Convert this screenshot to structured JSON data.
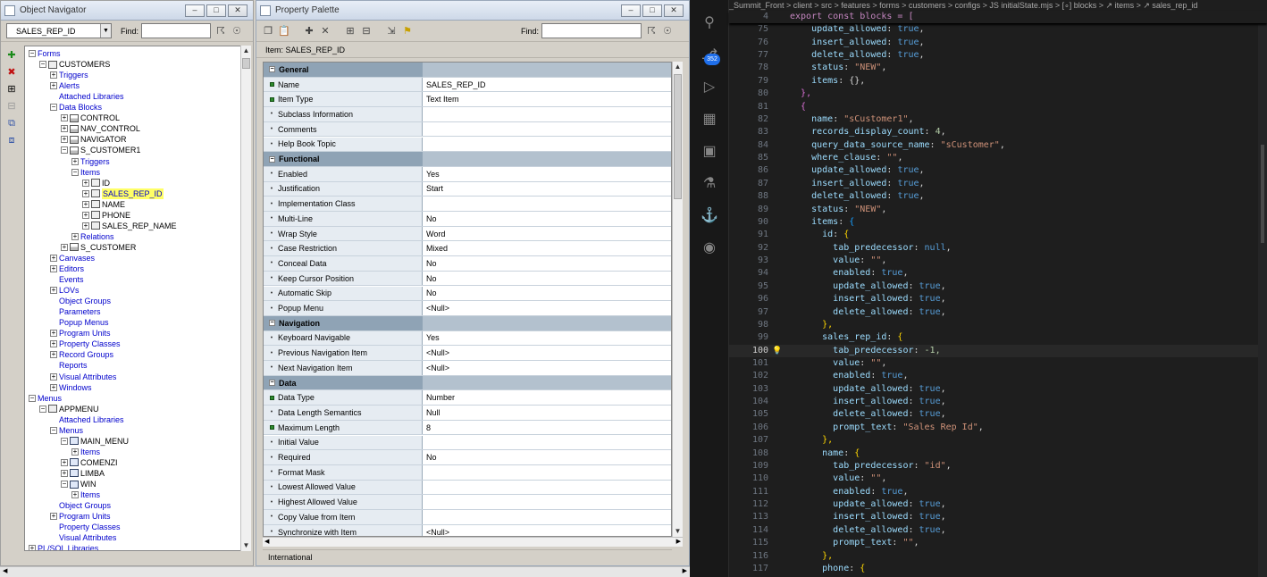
{
  "navigator": {
    "title": "Object Navigator",
    "selector_value": "SALES_REP_ID",
    "find_label": "Find:",
    "tree": [
      {
        "depth": 0,
        "toggle": "-",
        "icon": "",
        "label": "Forms",
        "color": "blue"
      },
      {
        "depth": 1,
        "toggle": "-",
        "icon": "form",
        "label": "CUSTOMERS",
        "color": "black"
      },
      {
        "depth": 2,
        "toggle": "+",
        "icon": "",
        "label": "Triggers",
        "color": "blue"
      },
      {
        "depth": 2,
        "toggle": "+",
        "icon": "",
        "label": "Alerts",
        "color": "blue"
      },
      {
        "depth": 2,
        "toggle": "",
        "icon": "",
        "label": "Attached Libraries",
        "color": "blue"
      },
      {
        "depth": 2,
        "toggle": "-",
        "icon": "",
        "label": "Data Blocks",
        "color": "blue"
      },
      {
        "depth": 3,
        "toggle": "+",
        "icon": "block",
        "label": "CONTROL",
        "color": "black"
      },
      {
        "depth": 3,
        "toggle": "+",
        "icon": "block",
        "label": "NAV_CONTROL",
        "color": "black"
      },
      {
        "depth": 3,
        "toggle": "+",
        "icon": "block",
        "label": "NAVIGATOR",
        "color": "black"
      },
      {
        "depth": 3,
        "toggle": "-",
        "icon": "block",
        "label": "S_CUSTOMER1",
        "color": "black"
      },
      {
        "depth": 4,
        "toggle": "+",
        "icon": "",
        "label": "Triggers",
        "color": "blue"
      },
      {
        "depth": 4,
        "toggle": "-",
        "icon": "",
        "label": "Items",
        "color": "blue"
      },
      {
        "depth": 5,
        "toggle": "+",
        "icon": "item",
        "label": "ID",
        "color": "black"
      },
      {
        "depth": 5,
        "toggle": "+",
        "icon": "item",
        "label": "SALES_REP_ID",
        "color": "selected"
      },
      {
        "depth": 5,
        "toggle": "+",
        "icon": "item",
        "label": "NAME",
        "color": "black"
      },
      {
        "depth": 5,
        "toggle": "+",
        "icon": "item",
        "label": "PHONE",
        "color": "black"
      },
      {
        "depth": 5,
        "toggle": "+",
        "icon": "item",
        "label": "SALES_REP_NAME",
        "color": "black"
      },
      {
        "depth": 4,
        "toggle": "+",
        "icon": "",
        "label": "Relations",
        "color": "blue"
      },
      {
        "depth": 3,
        "toggle": "+",
        "icon": "block",
        "label": "S_CUSTOMER",
        "color": "black"
      },
      {
        "depth": 2,
        "toggle": "+",
        "icon": "",
        "label": "Canvases",
        "color": "blue"
      },
      {
        "depth": 2,
        "toggle": "+",
        "icon": "",
        "label": "Editors",
        "color": "blue"
      },
      {
        "depth": 2,
        "toggle": "",
        "icon": "",
        "label": "Events",
        "color": "blue"
      },
      {
        "depth": 2,
        "toggle": "+",
        "icon": "",
        "label": "LOVs",
        "color": "blue"
      },
      {
        "depth": 2,
        "toggle": "",
        "icon": "",
        "label": "Object Groups",
        "color": "blue"
      },
      {
        "depth": 2,
        "toggle": "",
        "icon": "",
        "label": "Parameters",
        "color": "blue"
      },
      {
        "depth": 2,
        "toggle": "",
        "icon": "",
        "label": "Popup Menus",
        "color": "blue"
      },
      {
        "depth": 2,
        "toggle": "+",
        "icon": "",
        "label": "Program Units",
        "color": "blue"
      },
      {
        "depth": 2,
        "toggle": "+",
        "icon": "",
        "label": "Property Classes",
        "color": "blue"
      },
      {
        "depth": 2,
        "toggle": "+",
        "icon": "",
        "label": "Record Groups",
        "color": "blue"
      },
      {
        "depth": 2,
        "toggle": "",
        "icon": "",
        "label": "Reports",
        "color": "blue"
      },
      {
        "depth": 2,
        "toggle": "+",
        "icon": "",
        "label": "Visual Attributes",
        "color": "blue"
      },
      {
        "depth": 2,
        "toggle": "+",
        "icon": "",
        "label": "Windows",
        "color": "blue"
      },
      {
        "depth": 0,
        "toggle": "-",
        "icon": "",
        "label": "Menus",
        "color": "blue"
      },
      {
        "depth": 1,
        "toggle": "-",
        "icon": "form",
        "label": "APPMENU",
        "color": "black"
      },
      {
        "depth": 2,
        "toggle": "",
        "icon": "",
        "label": "Attached Libraries",
        "color": "blue"
      },
      {
        "depth": 2,
        "toggle": "-",
        "icon": "",
        "label": "Menus",
        "color": "blue"
      },
      {
        "depth": 3,
        "toggle": "-",
        "icon": "menu",
        "label": "MAIN_MENU",
        "color": "black"
      },
      {
        "depth": 4,
        "toggle": "+",
        "icon": "",
        "label": "Items",
        "color": "blue"
      },
      {
        "depth": 3,
        "toggle": "+",
        "icon": "menu",
        "label": "COMENZI",
        "color": "black"
      },
      {
        "depth": 3,
        "toggle": "+",
        "icon": "menu",
        "label": "LIMBA",
        "color": "black"
      },
      {
        "depth": 3,
        "toggle": "-",
        "icon": "menu",
        "label": "WIN",
        "color": "black"
      },
      {
        "depth": 4,
        "toggle": "+",
        "icon": "",
        "label": "Items",
        "color": "blue"
      },
      {
        "depth": 2,
        "toggle": "",
        "icon": "",
        "label": "Object Groups",
        "color": "blue"
      },
      {
        "depth": 2,
        "toggle": "+",
        "icon": "",
        "label": "Program Units",
        "color": "blue"
      },
      {
        "depth": 2,
        "toggle": "",
        "icon": "",
        "label": "Property Classes",
        "color": "blue"
      },
      {
        "depth": 2,
        "toggle": "",
        "icon": "",
        "label": "Visual Attributes",
        "color": "blue"
      },
      {
        "depth": 0,
        "toggle": "+",
        "icon": "",
        "label": "PL/SQL Libraries",
        "color": "blue"
      }
    ]
  },
  "palette": {
    "title": "Property Palette",
    "find_label": "Find:",
    "item_label": "Item: SALES_REP_ID",
    "status": "International",
    "rows": [
      {
        "type": "cat",
        "name": "General",
        "value": ""
      },
      {
        "type": "prop",
        "mark": "sq",
        "name": "Name",
        "value": "SALES_REP_ID"
      },
      {
        "type": "prop",
        "mark": "sq",
        "name": "Item Type",
        "value": "Text Item"
      },
      {
        "type": "prop",
        "mark": "dot",
        "name": "Subclass Information",
        "value": ""
      },
      {
        "type": "prop",
        "mark": "dot",
        "name": "Comments",
        "value": ""
      },
      {
        "type": "prop",
        "mark": "dot",
        "name": "Help Book Topic",
        "value": ""
      },
      {
        "type": "cat",
        "name": "Functional",
        "value": ""
      },
      {
        "type": "prop",
        "mark": "dot",
        "name": "Enabled",
        "value": "Yes"
      },
      {
        "type": "prop",
        "mark": "dot",
        "name": "Justification",
        "value": "Start"
      },
      {
        "type": "prop",
        "mark": "dot",
        "name": "Implementation Class",
        "value": ""
      },
      {
        "type": "prop",
        "mark": "dot",
        "name": "Multi-Line",
        "value": "No"
      },
      {
        "type": "prop",
        "mark": "dot",
        "name": "Wrap Style",
        "value": "Word"
      },
      {
        "type": "prop",
        "mark": "dot",
        "name": "Case Restriction",
        "value": "Mixed"
      },
      {
        "type": "prop",
        "mark": "dot",
        "name": "Conceal Data",
        "value": "No"
      },
      {
        "type": "prop",
        "mark": "dot",
        "name": "Keep Cursor Position",
        "value": "No"
      },
      {
        "type": "prop",
        "mark": "dot",
        "name": "Automatic Skip",
        "value": "No"
      },
      {
        "type": "prop",
        "mark": "dot",
        "name": "Popup Menu",
        "value": "<Null>"
      },
      {
        "type": "cat",
        "name": "Navigation",
        "value": ""
      },
      {
        "type": "prop",
        "mark": "dot",
        "name": "Keyboard Navigable",
        "value": "Yes"
      },
      {
        "type": "prop",
        "mark": "dot",
        "name": "Previous Navigation Item",
        "value": "<Null>"
      },
      {
        "type": "prop",
        "mark": "dot",
        "name": "Next Navigation Item",
        "value": "<Null>"
      },
      {
        "type": "cat",
        "name": "Data",
        "value": ""
      },
      {
        "type": "prop",
        "mark": "sq",
        "name": "Data Type",
        "value": "Number"
      },
      {
        "type": "prop",
        "mark": "dot",
        "name": "Data Length Semantics",
        "value": "Null"
      },
      {
        "type": "prop",
        "mark": "sq",
        "name": "Maximum Length",
        "value": "8"
      },
      {
        "type": "prop",
        "mark": "dot",
        "name": "Initial Value",
        "value": ""
      },
      {
        "type": "prop",
        "mark": "dot",
        "name": "Required",
        "value": "No"
      },
      {
        "type": "prop",
        "mark": "dot",
        "name": "Format Mask",
        "value": ""
      },
      {
        "type": "prop",
        "mark": "dot",
        "name": "Lowest Allowed Value",
        "value": ""
      },
      {
        "type": "prop",
        "mark": "dot",
        "name": "Highest Allowed Value",
        "value": ""
      },
      {
        "type": "prop",
        "mark": "dot",
        "name": "Copy Value from Item",
        "value": ""
      },
      {
        "type": "prop",
        "mark": "dot",
        "name": "Synchronize with Item",
        "value": "<Null>"
      }
    ]
  },
  "vscode": {
    "breadcrumbs": "_Summit_Front > client > src > features > forms > customers > configs > JS initialState.mjs > [∘] blocks > ↗ items > ↗ sales_rep_id",
    "badge": "352",
    "sticky_line": {
      "num": "4",
      "text": "export const blocks = ["
    },
    "current_line": "100",
    "lines": [
      {
        "num": "75",
        "indent": 2,
        "k": "update_allowed",
        "v": "true",
        "vt": "bool"
      },
      {
        "num": "76",
        "indent": 2,
        "k": "insert_allowed",
        "v": "true",
        "vt": "bool"
      },
      {
        "num": "77",
        "indent": 2,
        "k": "delete_allowed",
        "v": "true",
        "vt": "bool"
      },
      {
        "num": "78",
        "indent": 2,
        "k": "status",
        "v": "\"NEW\"",
        "vt": "str"
      },
      {
        "num": "79",
        "indent": 2,
        "k": "items",
        "v": "{}",
        "vt": "pun"
      },
      {
        "num": "80",
        "indent": 1,
        "k": "",
        "v": "},",
        "vt": "br2"
      },
      {
        "num": "81",
        "indent": 1,
        "k": "",
        "v": "{",
        "vt": "br2"
      },
      {
        "num": "82",
        "indent": 2,
        "k": "name",
        "v": "\"sCustomer1\"",
        "vt": "str"
      },
      {
        "num": "83",
        "indent": 2,
        "k": "records_display_count",
        "v": "4",
        "vt": "num"
      },
      {
        "num": "84",
        "indent": 2,
        "k": "query_data_source_name",
        "v": "\"sCustomer\"",
        "vt": "str"
      },
      {
        "num": "85",
        "indent": 2,
        "k": "where_clause",
        "v": "\"\"",
        "vt": "str"
      },
      {
        "num": "86",
        "indent": 2,
        "k": "update_allowed",
        "v": "true",
        "vt": "bool"
      },
      {
        "num": "87",
        "indent": 2,
        "k": "insert_allowed",
        "v": "true",
        "vt": "bool"
      },
      {
        "num": "88",
        "indent": 2,
        "k": "delete_allowed",
        "v": "true",
        "vt": "bool"
      },
      {
        "num": "89",
        "indent": 2,
        "k": "status",
        "v": "\"NEW\"",
        "vt": "str"
      },
      {
        "num": "90",
        "indent": 2,
        "k": "items",
        "v": "{",
        "vt": "br3"
      },
      {
        "num": "91",
        "indent": 3,
        "k": "id",
        "v": "{",
        "vt": "br1"
      },
      {
        "num": "92",
        "indent": 4,
        "k": "tab_predecessor",
        "v": "null",
        "vt": "bool"
      },
      {
        "num": "93",
        "indent": 4,
        "k": "value",
        "v": "\"\"",
        "vt": "str"
      },
      {
        "num": "94",
        "indent": 4,
        "k": "enabled",
        "v": "true",
        "vt": "bool"
      },
      {
        "num": "95",
        "indent": 4,
        "k": "update_allowed",
        "v": "true",
        "vt": "bool"
      },
      {
        "num": "96",
        "indent": 4,
        "k": "insert_allowed",
        "v": "true",
        "vt": "bool"
      },
      {
        "num": "97",
        "indent": 4,
        "k": "delete_allowed",
        "v": "true",
        "vt": "bool"
      },
      {
        "num": "98",
        "indent": 3,
        "k": "",
        "v": "},",
        "vt": "br1"
      },
      {
        "num": "99",
        "indent": 3,
        "k": "sales_rep_id",
        "v": "{",
        "vt": "br1"
      },
      {
        "num": "100",
        "indent": 4,
        "k": "tab_predecessor",
        "v": "-1,",
        "vt": "num"
      },
      {
        "num": "101",
        "indent": 4,
        "k": "value",
        "v": "\"\"",
        "vt": "str"
      },
      {
        "num": "102",
        "indent": 4,
        "k": "enabled",
        "v": "true",
        "vt": "bool"
      },
      {
        "num": "103",
        "indent": 4,
        "k": "update_allowed",
        "v": "true",
        "vt": "bool"
      },
      {
        "num": "104",
        "indent": 4,
        "k": "insert_allowed",
        "v": "true",
        "vt": "bool"
      },
      {
        "num": "105",
        "indent": 4,
        "k": "delete_allowed",
        "v": "true",
        "vt": "bool"
      },
      {
        "num": "106",
        "indent": 4,
        "k": "prompt_text",
        "v": "\"Sales Rep Id\"",
        "vt": "str"
      },
      {
        "num": "107",
        "indent": 3,
        "k": "",
        "v": "},",
        "vt": "br1"
      },
      {
        "num": "108",
        "indent": 3,
        "k": "name",
        "v": "{",
        "vt": "br1"
      },
      {
        "num": "109",
        "indent": 4,
        "k": "tab_predecessor",
        "v": "\"id\"",
        "vt": "str"
      },
      {
        "num": "110",
        "indent": 4,
        "k": "value",
        "v": "\"\"",
        "vt": "str"
      },
      {
        "num": "111",
        "indent": 4,
        "k": "enabled",
        "v": "true",
        "vt": "bool"
      },
      {
        "num": "112",
        "indent": 4,
        "k": "update_allowed",
        "v": "true",
        "vt": "bool"
      },
      {
        "num": "113",
        "indent": 4,
        "k": "insert_allowed",
        "v": "true",
        "vt": "bool"
      },
      {
        "num": "114",
        "indent": 4,
        "k": "delete_allowed",
        "v": "true",
        "vt": "bool"
      },
      {
        "num": "115",
        "indent": 4,
        "k": "prompt_text",
        "v": "\"\"",
        "vt": "str"
      },
      {
        "num": "116",
        "indent": 3,
        "k": "",
        "v": "},",
        "vt": "br1"
      },
      {
        "num": "117",
        "indent": 3,
        "k": "phone",
        "v": "{",
        "vt": "br1"
      }
    ]
  }
}
